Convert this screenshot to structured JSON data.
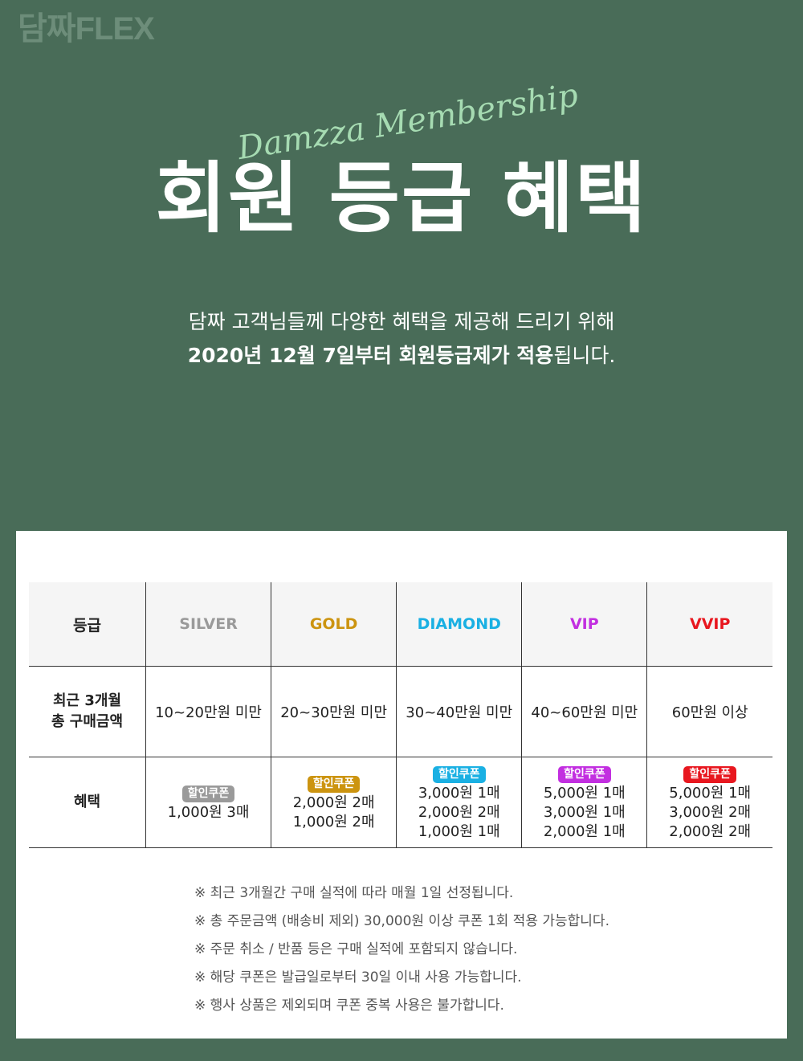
{
  "brand": {
    "logo": "담짜FLEX"
  },
  "hero": {
    "script_title": "Damzza Membership",
    "title": "회원 등급 혜택",
    "intro_line1": "담짜 고객님들께 다양한 혜택을 제공해 드리기 위해",
    "intro_line2_bold": "2020년 12월 7일부터 회원등급제가 적용",
    "intro_line2_rest": "됩니다."
  },
  "table": {
    "header_label": "등급",
    "grades": [
      {
        "name": "SILVER",
        "color": "#9a9a9a"
      },
      {
        "name": "GOLD",
        "color": "#cc9410"
      },
      {
        "name": "DIAMOND",
        "color": "#1ab0e3"
      },
      {
        "name": "VIP",
        "color": "#c22fe0"
      },
      {
        "name": "VVIP",
        "color": "#e8171f"
      }
    ],
    "amount_label_line1": "최근 3개월",
    "amount_label_line2": "총 구매금액",
    "amounts": [
      "10~20만원 미만",
      "20~30만원 미만",
      "30~40만원 미만",
      "40~60만원 미만",
      "60만원 이상"
    ],
    "benefit_label": "혜택",
    "coupon_badge": "할인쿠폰",
    "benefits": [
      {
        "lines": [
          "1,000원 3매"
        ]
      },
      {
        "lines": [
          "2,000원 2매",
          "1,000원 2매"
        ]
      },
      {
        "lines": [
          "3,000원 1매",
          "2,000원 2매",
          "1,000원 1매"
        ]
      },
      {
        "lines": [
          "5,000원 1매",
          "3,000원 1매",
          "2,000원 1매"
        ]
      },
      {
        "lines": [
          "5,000원 1매",
          "3,000원 2매",
          "2,000원 2매"
        ]
      }
    ]
  },
  "notes": [
    "※ 최근 3개월간 구매 실적에 따라 매월 1일 선정됩니다.",
    "※ 총 주문금액 (배송비 제외) 30,000원 이상 쿠폰 1회 적용 가능합니다.",
    "※ 주문 취소 / 반품 등은 구매 실적에 포함되지 않습니다.",
    "※ 해당 쿠폰은 발급일로부터 30일 이내 사용 가능합니다.",
    "※ 행사 상품은 제외되며 쿠폰 중복 사용은 불가합니다."
  ]
}
